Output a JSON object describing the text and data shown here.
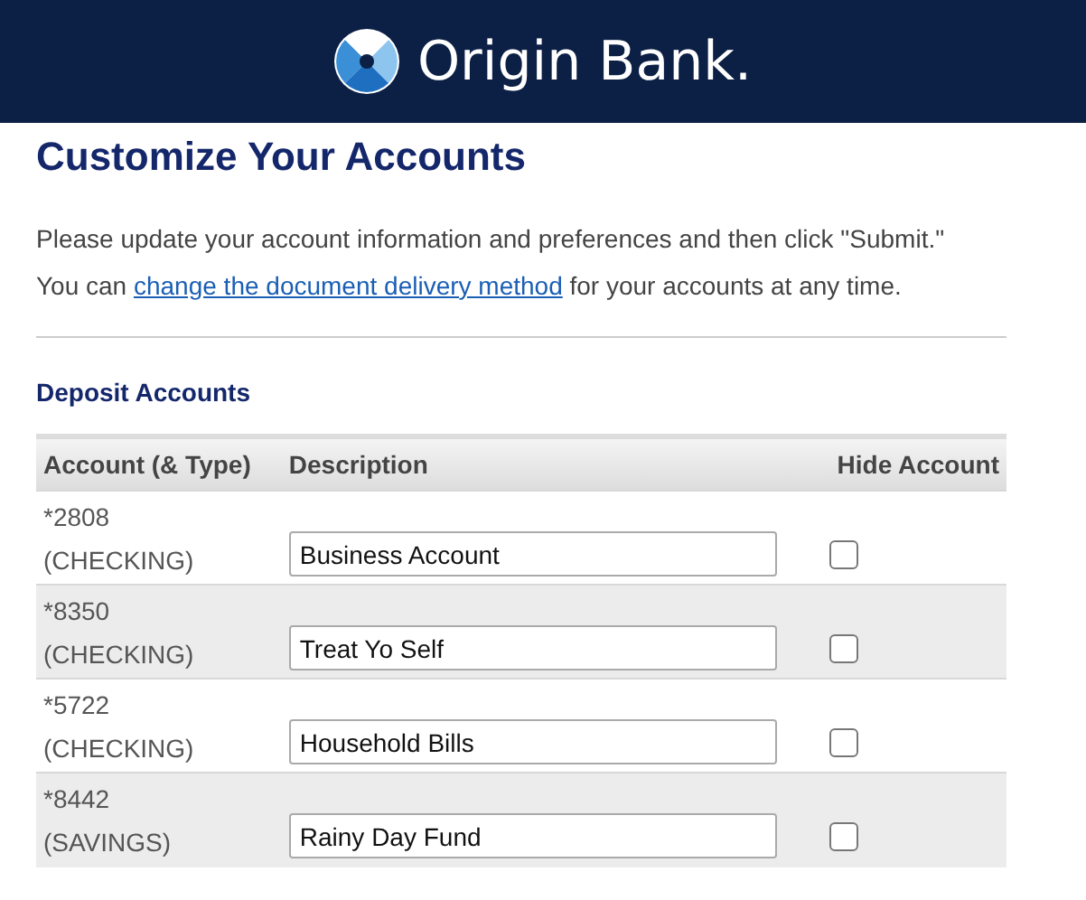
{
  "header": {
    "brand": "Origin Bank."
  },
  "title": "Customize Your Accounts",
  "intro": "Please update your account information and preferences and then click \"Submit.\"",
  "delivery": {
    "before": "You can ",
    "link": "change the document delivery method",
    "after": " for your accounts at any time."
  },
  "section": "Deposit Accounts",
  "table": {
    "columns": [
      "Account (& Type)",
      "Description",
      "Hide Account"
    ],
    "rows": [
      {
        "account": "*2808",
        "type": "(CHECKING)",
        "description": "Business Account",
        "hidden": false
      },
      {
        "account": "*8350",
        "type": "(CHECKING)",
        "description": "Treat Yo Self",
        "hidden": false
      },
      {
        "account": "*5722",
        "type": "(CHECKING)",
        "description": "Household Bills",
        "hidden": false
      },
      {
        "account": "*8442",
        "type": "(SAVINGS)",
        "description": "Rainy Day Fund",
        "hidden": false
      }
    ]
  }
}
